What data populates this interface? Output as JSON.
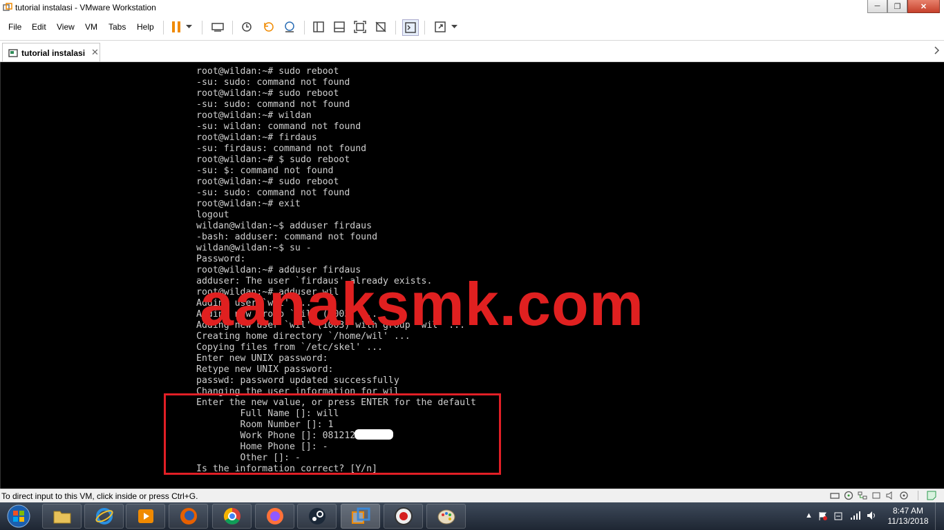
{
  "window": {
    "title": "tutorial instalasi - VMware Workstation",
    "min_glyph": "─",
    "max_glyph": "❐",
    "close_glyph": "✕"
  },
  "menu": {
    "file": "File",
    "edit": "Edit",
    "view": "View",
    "vm": "VM",
    "tabs": "Tabs",
    "help": "Help"
  },
  "tab": {
    "label": "tutorial instalasi",
    "close_glyph": "✕"
  },
  "terminal": {
    "lines": [
      "root@wildan:~# sudo reboot",
      "-su: sudo: command not found",
      "root@wildan:~# sudo reboot",
      "-su: sudo: command not found",
      "root@wildan:~# wildan",
      "-su: wildan: command not found",
      "root@wildan:~# firdaus",
      "-su: firdaus: command not found",
      "root@wildan:~# $ sudo reboot",
      "-su: $: command not found",
      "root@wildan:~# sudo reboot",
      "-su: sudo: command not found",
      "root@wildan:~# exit",
      "logout",
      "wildan@wildan:~$ adduser firdaus",
      "-bash: adduser: command not found",
      "wildan@wildan:~$ su -",
      "Password:",
      "root@wildan:~# adduser firdaus",
      "adduser: The user `firdaus' already exists.",
      "root@wildan:~# adduser wil",
      "Adding user `wil' ...",
      "Adding new group `wil' (1003) ...",
      "Adding new user `wil' (1003) with group `wil' ...",
      "Creating home directory `/home/wil' ...",
      "Copying files from `/etc/skel' ...",
      "Enter new UNIX password:",
      "Retype new UNIX password:",
      "passwd: password updated successfully",
      "Changing the user information for wil",
      "Enter the new value, or press ENTER for the default",
      "        Full Name []: will",
      "        Room Number []: 1",
      "        Work Phone []: 081212",
      "        Home Phone []: -",
      "        Other []: -",
      "Is the information correct? [Y/n]"
    ]
  },
  "watermark": "aanaksmk.com",
  "status": {
    "hint": "To direct input to this VM, click inside or press Ctrl+G."
  },
  "taskbar": {
    "apps": [
      "file-explorer",
      "internet-explorer",
      "media-player",
      "firefox",
      "chrome",
      "firefox-dev",
      "steam",
      "vmware",
      "obs",
      "paint"
    ],
    "active": "vmware"
  },
  "clock": {
    "time": "8:47 AM",
    "date": "11/13/2018"
  },
  "colors": {
    "accent_red": "#e21f26",
    "terminal_fg": "#d0d0d0",
    "vmware_orange": "#f08a00"
  }
}
